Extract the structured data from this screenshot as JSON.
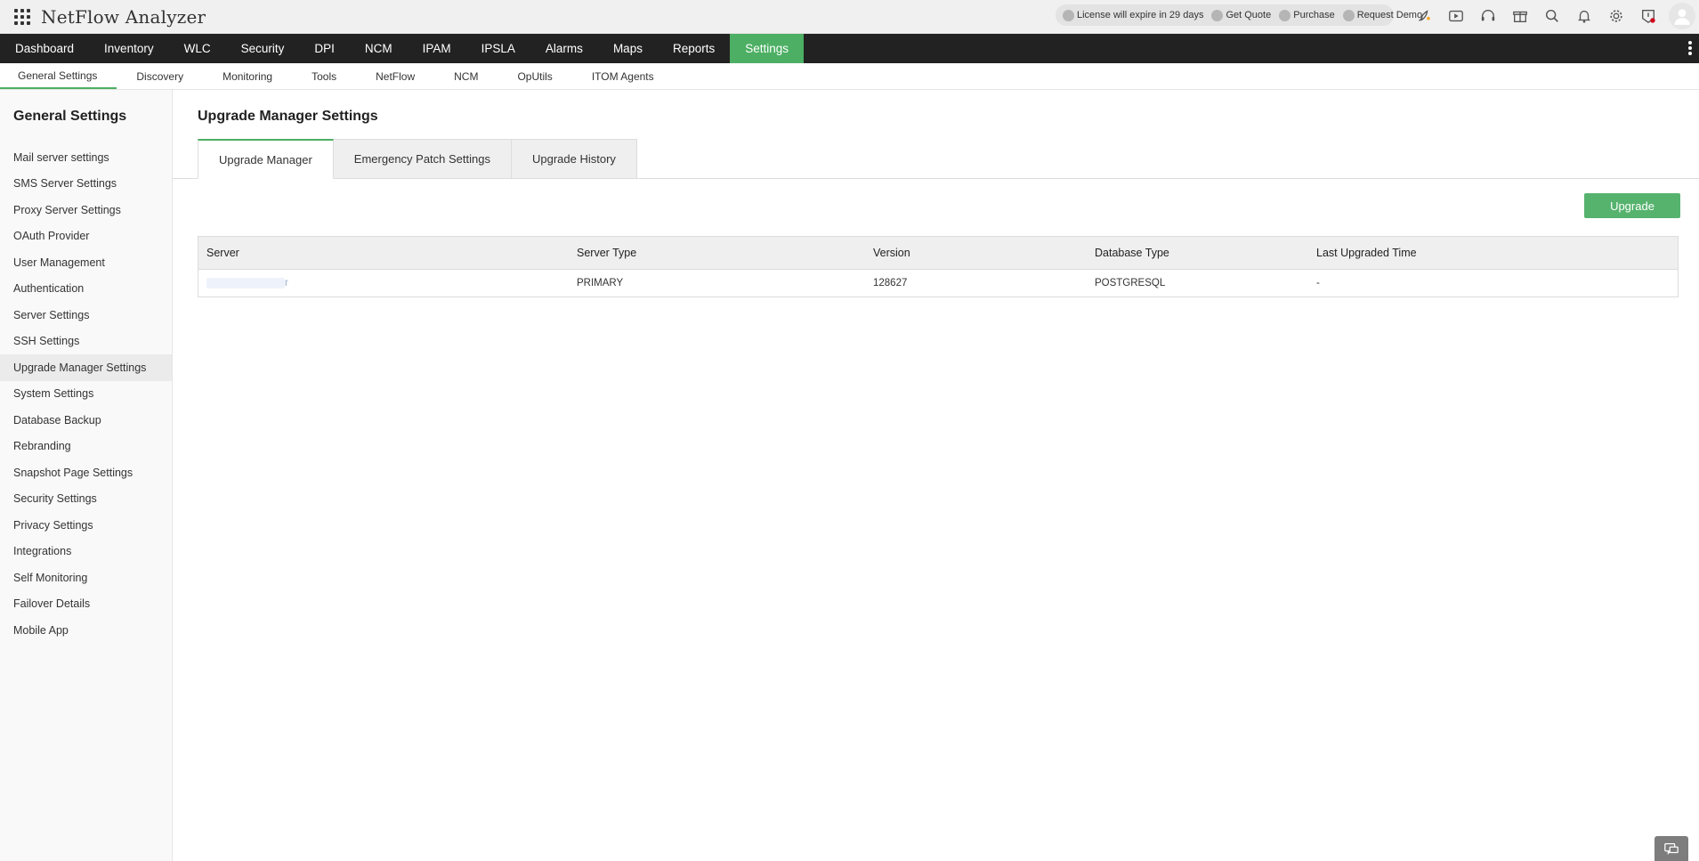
{
  "app": {
    "title": "NetFlow Analyzer"
  },
  "license_bar": {
    "license": "License will expire in 29 days",
    "get_quote": "Get Quote",
    "purchase": "Purchase",
    "request_demo": "Request Demo"
  },
  "top_icons": [
    "rocket-icon",
    "star-icon",
    "video-icon",
    "headset-icon",
    "gift-icon",
    "search-icon",
    "bell-icon",
    "gear-icon",
    "alert-shield-icon",
    "user-avatar-icon"
  ],
  "main_nav": [
    {
      "label": "Dashboard"
    },
    {
      "label": "Inventory"
    },
    {
      "label": "WLC"
    },
    {
      "label": "Security"
    },
    {
      "label": "DPI"
    },
    {
      "label": "NCM"
    },
    {
      "label": "IPAM"
    },
    {
      "label": "IPSLA"
    },
    {
      "label": "Alarms"
    },
    {
      "label": "Maps"
    },
    {
      "label": "Reports"
    },
    {
      "label": "Settings",
      "active": true
    }
  ],
  "sub_nav": [
    {
      "label": "General Settings",
      "active": true
    },
    {
      "label": "Discovery"
    },
    {
      "label": "Monitoring"
    },
    {
      "label": "Tools"
    },
    {
      "label": "NetFlow"
    },
    {
      "label": "NCM"
    },
    {
      "label": "OpUtils"
    },
    {
      "label": "ITOM Agents"
    }
  ],
  "sidebar": {
    "title": "General Settings",
    "items": [
      "Mail server settings",
      "SMS Server Settings",
      "Proxy Server Settings",
      "OAuth Provider",
      "User Management",
      "Authentication",
      "Server Settings",
      "SSH Settings",
      "Upgrade Manager Settings",
      "System Settings",
      "Database Backup",
      "Rebranding",
      "Snapshot Page Settings",
      "Security Settings",
      "Privacy Settings",
      "Integrations",
      "Self Monitoring",
      "Failover Details",
      "Mobile App"
    ],
    "active_index": 8
  },
  "main": {
    "title": "Upgrade Manager Settings",
    "tabs": [
      "Upgrade Manager",
      "Emergency Patch Settings",
      "Upgrade History"
    ],
    "upgrade_label": "Upgrade",
    "table": {
      "headers": [
        "Server",
        "Server Type",
        "Version",
        "Database Type",
        "Last Upgraded Time"
      ],
      "rows": [
        {
          "server_suffix": "r",
          "server_type": "PRIMARY",
          "version": "128627",
          "database_type": "POSTGRESQL",
          "last_upgraded": "-"
        }
      ]
    }
  },
  "colors": {
    "accent": "#4caf63",
    "nav_bg": "#222222",
    "button": "#56b36e"
  }
}
